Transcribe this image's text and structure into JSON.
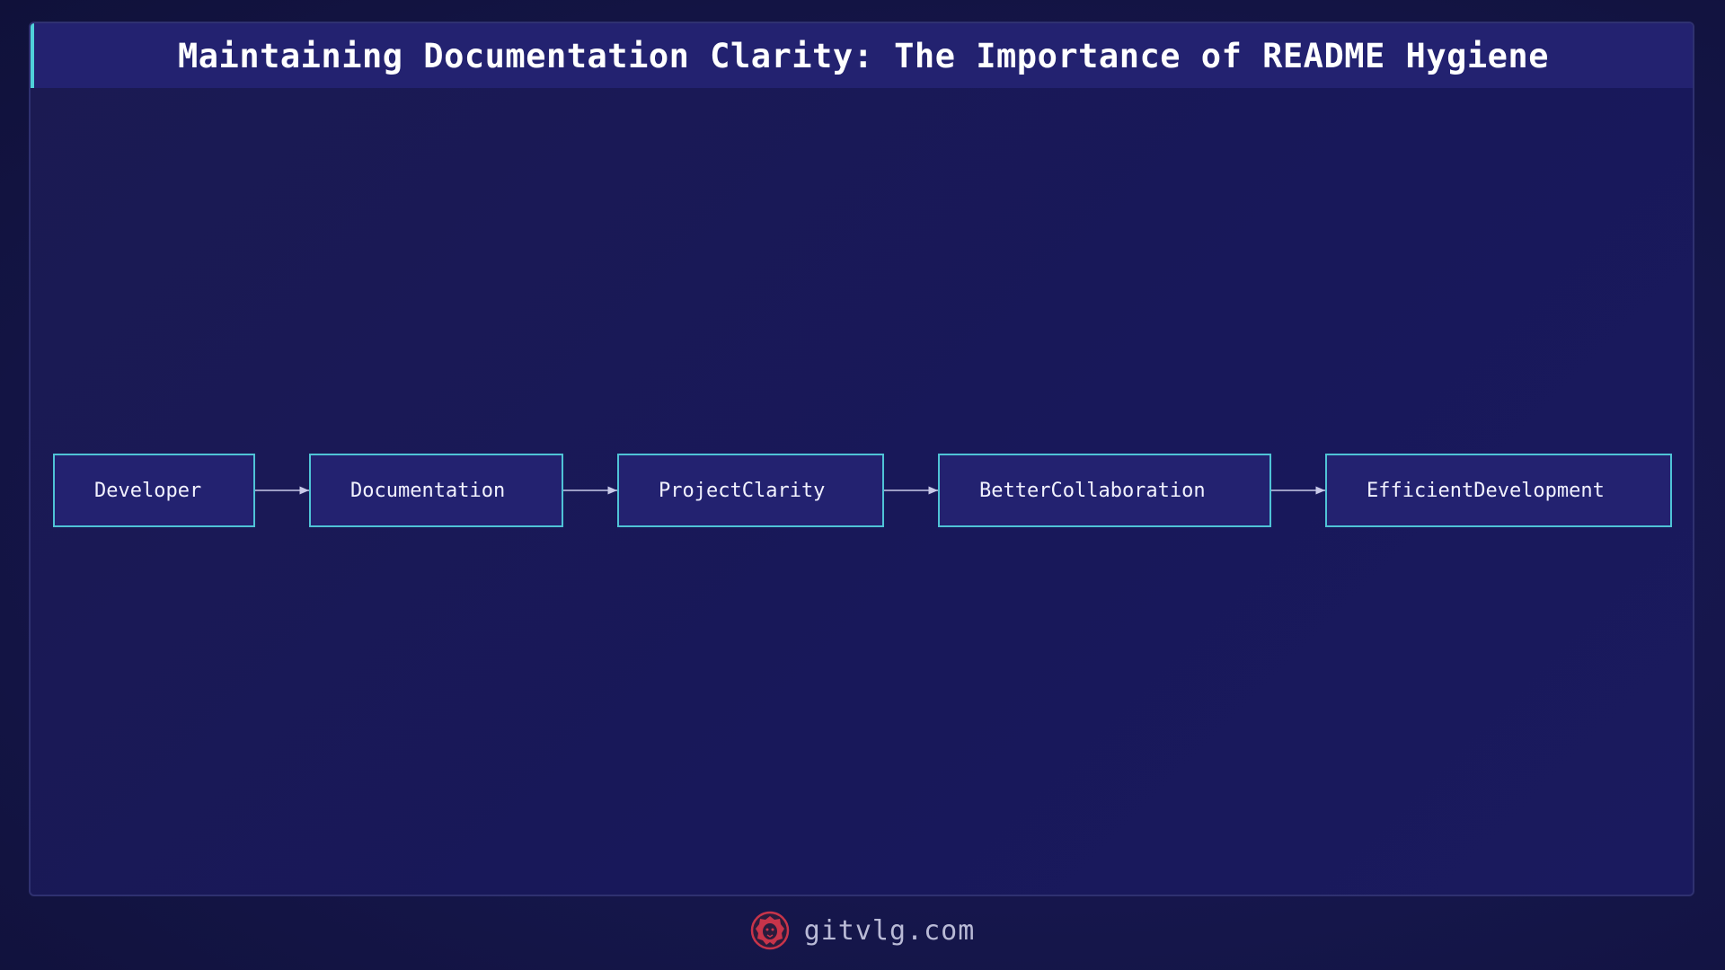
{
  "title": "Maintaining Documentation Clarity: The Importance of README Hygiene",
  "nodes": [
    {
      "label": "Developer"
    },
    {
      "label": "Documentation"
    },
    {
      "label": "ProjectClarity"
    },
    {
      "label": "BetterCollaboration"
    },
    {
      "label": "EfficientDevelopment"
    }
  ],
  "edges": [
    {
      "from": "Developer",
      "to": "Documentation"
    },
    {
      "from": "Documentation",
      "to": "ProjectClarity"
    },
    {
      "from": "ProjectClarity",
      "to": "BetterCollaboration"
    },
    {
      "from": "BetterCollaboration",
      "to": "EfficientDevelopment"
    }
  ],
  "footer": {
    "site": "gitvlg.com",
    "logo_icon": "lion-head-icon"
  },
  "colors": {
    "node_fill": "#232270",
    "node_border": "#4fc3d6",
    "accent": "#4fd1d9",
    "logo": "#c7344a"
  }
}
